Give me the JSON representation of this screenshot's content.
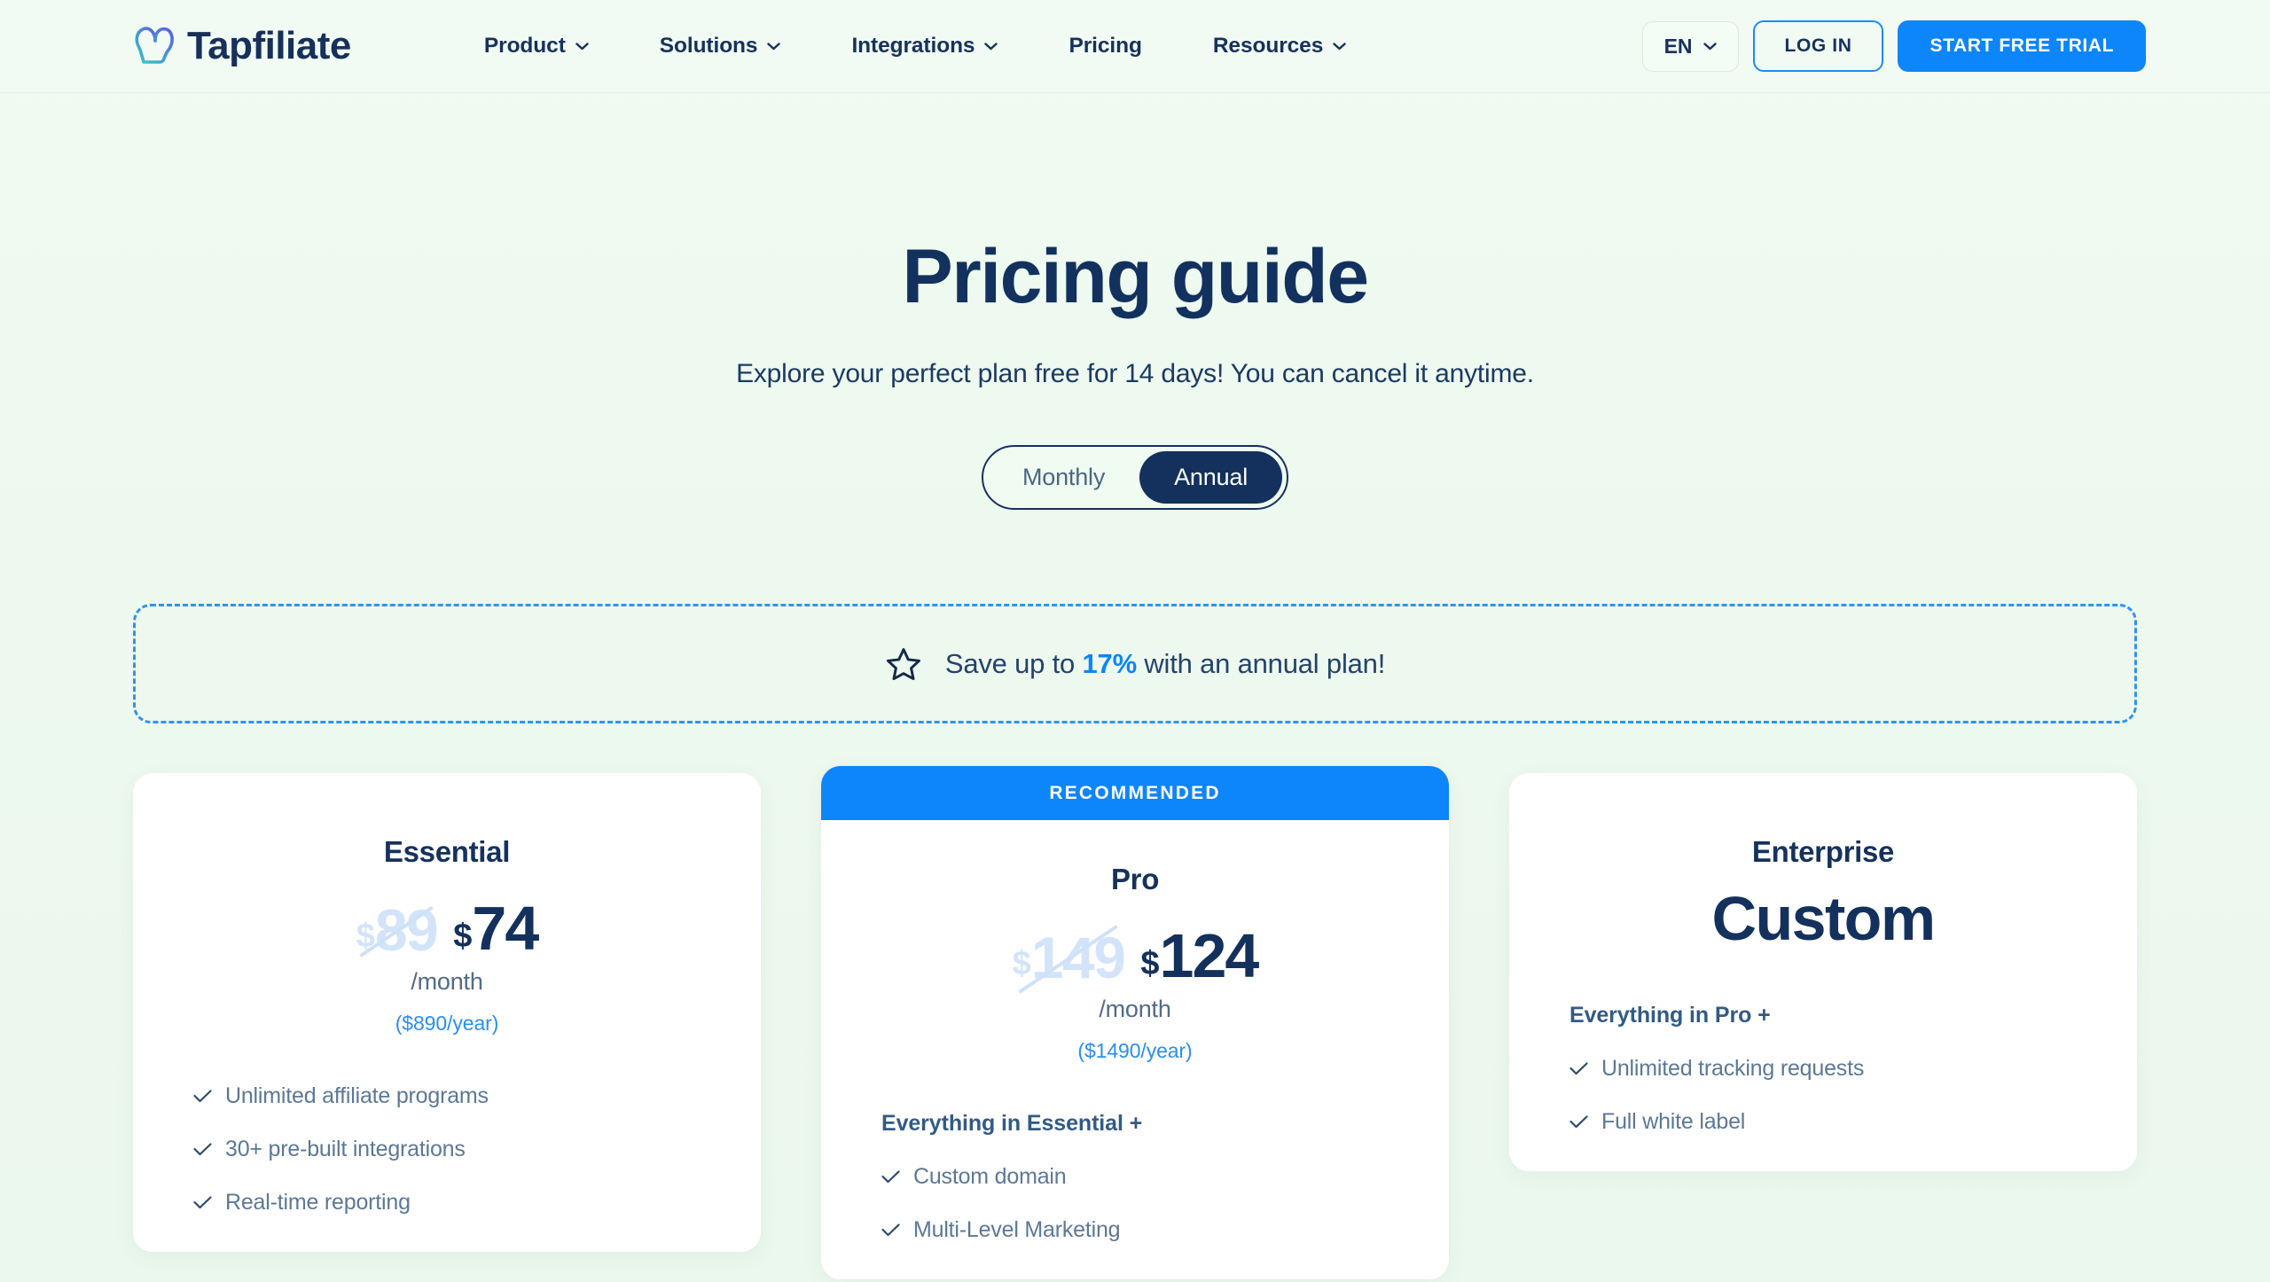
{
  "brand": {
    "name": "Tapfiliate",
    "logo_gradient_start": "#36c6c9",
    "logo_gradient_end": "#5b5fe0",
    "word_color": "#17305a"
  },
  "header": {
    "nav": [
      {
        "label": "Product",
        "has_caret": true
      },
      {
        "label": "Solutions",
        "has_caret": true
      },
      {
        "label": "Integrations",
        "has_caret": true
      },
      {
        "label": "Pricing",
        "has_caret": false
      },
      {
        "label": "Resources",
        "has_caret": true
      }
    ],
    "language": "EN",
    "login_label": "LOG IN",
    "trial_label": "START FREE TRIAL",
    "accent_color": "#0d85fb"
  },
  "hero": {
    "title": "Pricing guide",
    "subtitle": "Explore your perfect plan free for 14 days! You can cancel it anytime."
  },
  "billing_toggle": {
    "options": [
      "Monthly",
      "Annual"
    ],
    "selected": "Annual"
  },
  "banner": {
    "icon": "star-icon",
    "text_before": "Save up to ",
    "highlight": "17%",
    "text_after": " with an annual plan!",
    "highlight_color": "#0d85fb",
    "border_color": "#2f93f2"
  },
  "plans": [
    {
      "name": "Essential",
      "recommended": false,
      "ribbon": "",
      "old_currency": "$",
      "old_amount": "89",
      "currency": "$",
      "amount": "74",
      "period": "/month",
      "yearly": "($890/year)",
      "features_head": "",
      "features": [
        "Unlimited affiliate programs",
        "30+ pre-built integrations",
        "Real-time reporting"
      ]
    },
    {
      "name": "Pro",
      "recommended": true,
      "ribbon": "RECOMMENDED",
      "old_currency": "$",
      "old_amount": "149",
      "currency": "$",
      "amount": "124",
      "period": "/month",
      "yearly": "($1490/year)",
      "features_head": "Everything in Essential +",
      "features": [
        "Custom domain",
        "Multi-Level Marketing"
      ]
    },
    {
      "name": "Enterprise",
      "recommended": false,
      "ribbon": "",
      "custom_label": "Custom",
      "features_head": "Everything in Pro +",
      "features": [
        "Unlimited tracking requests",
        "Full white label"
      ]
    }
  ]
}
